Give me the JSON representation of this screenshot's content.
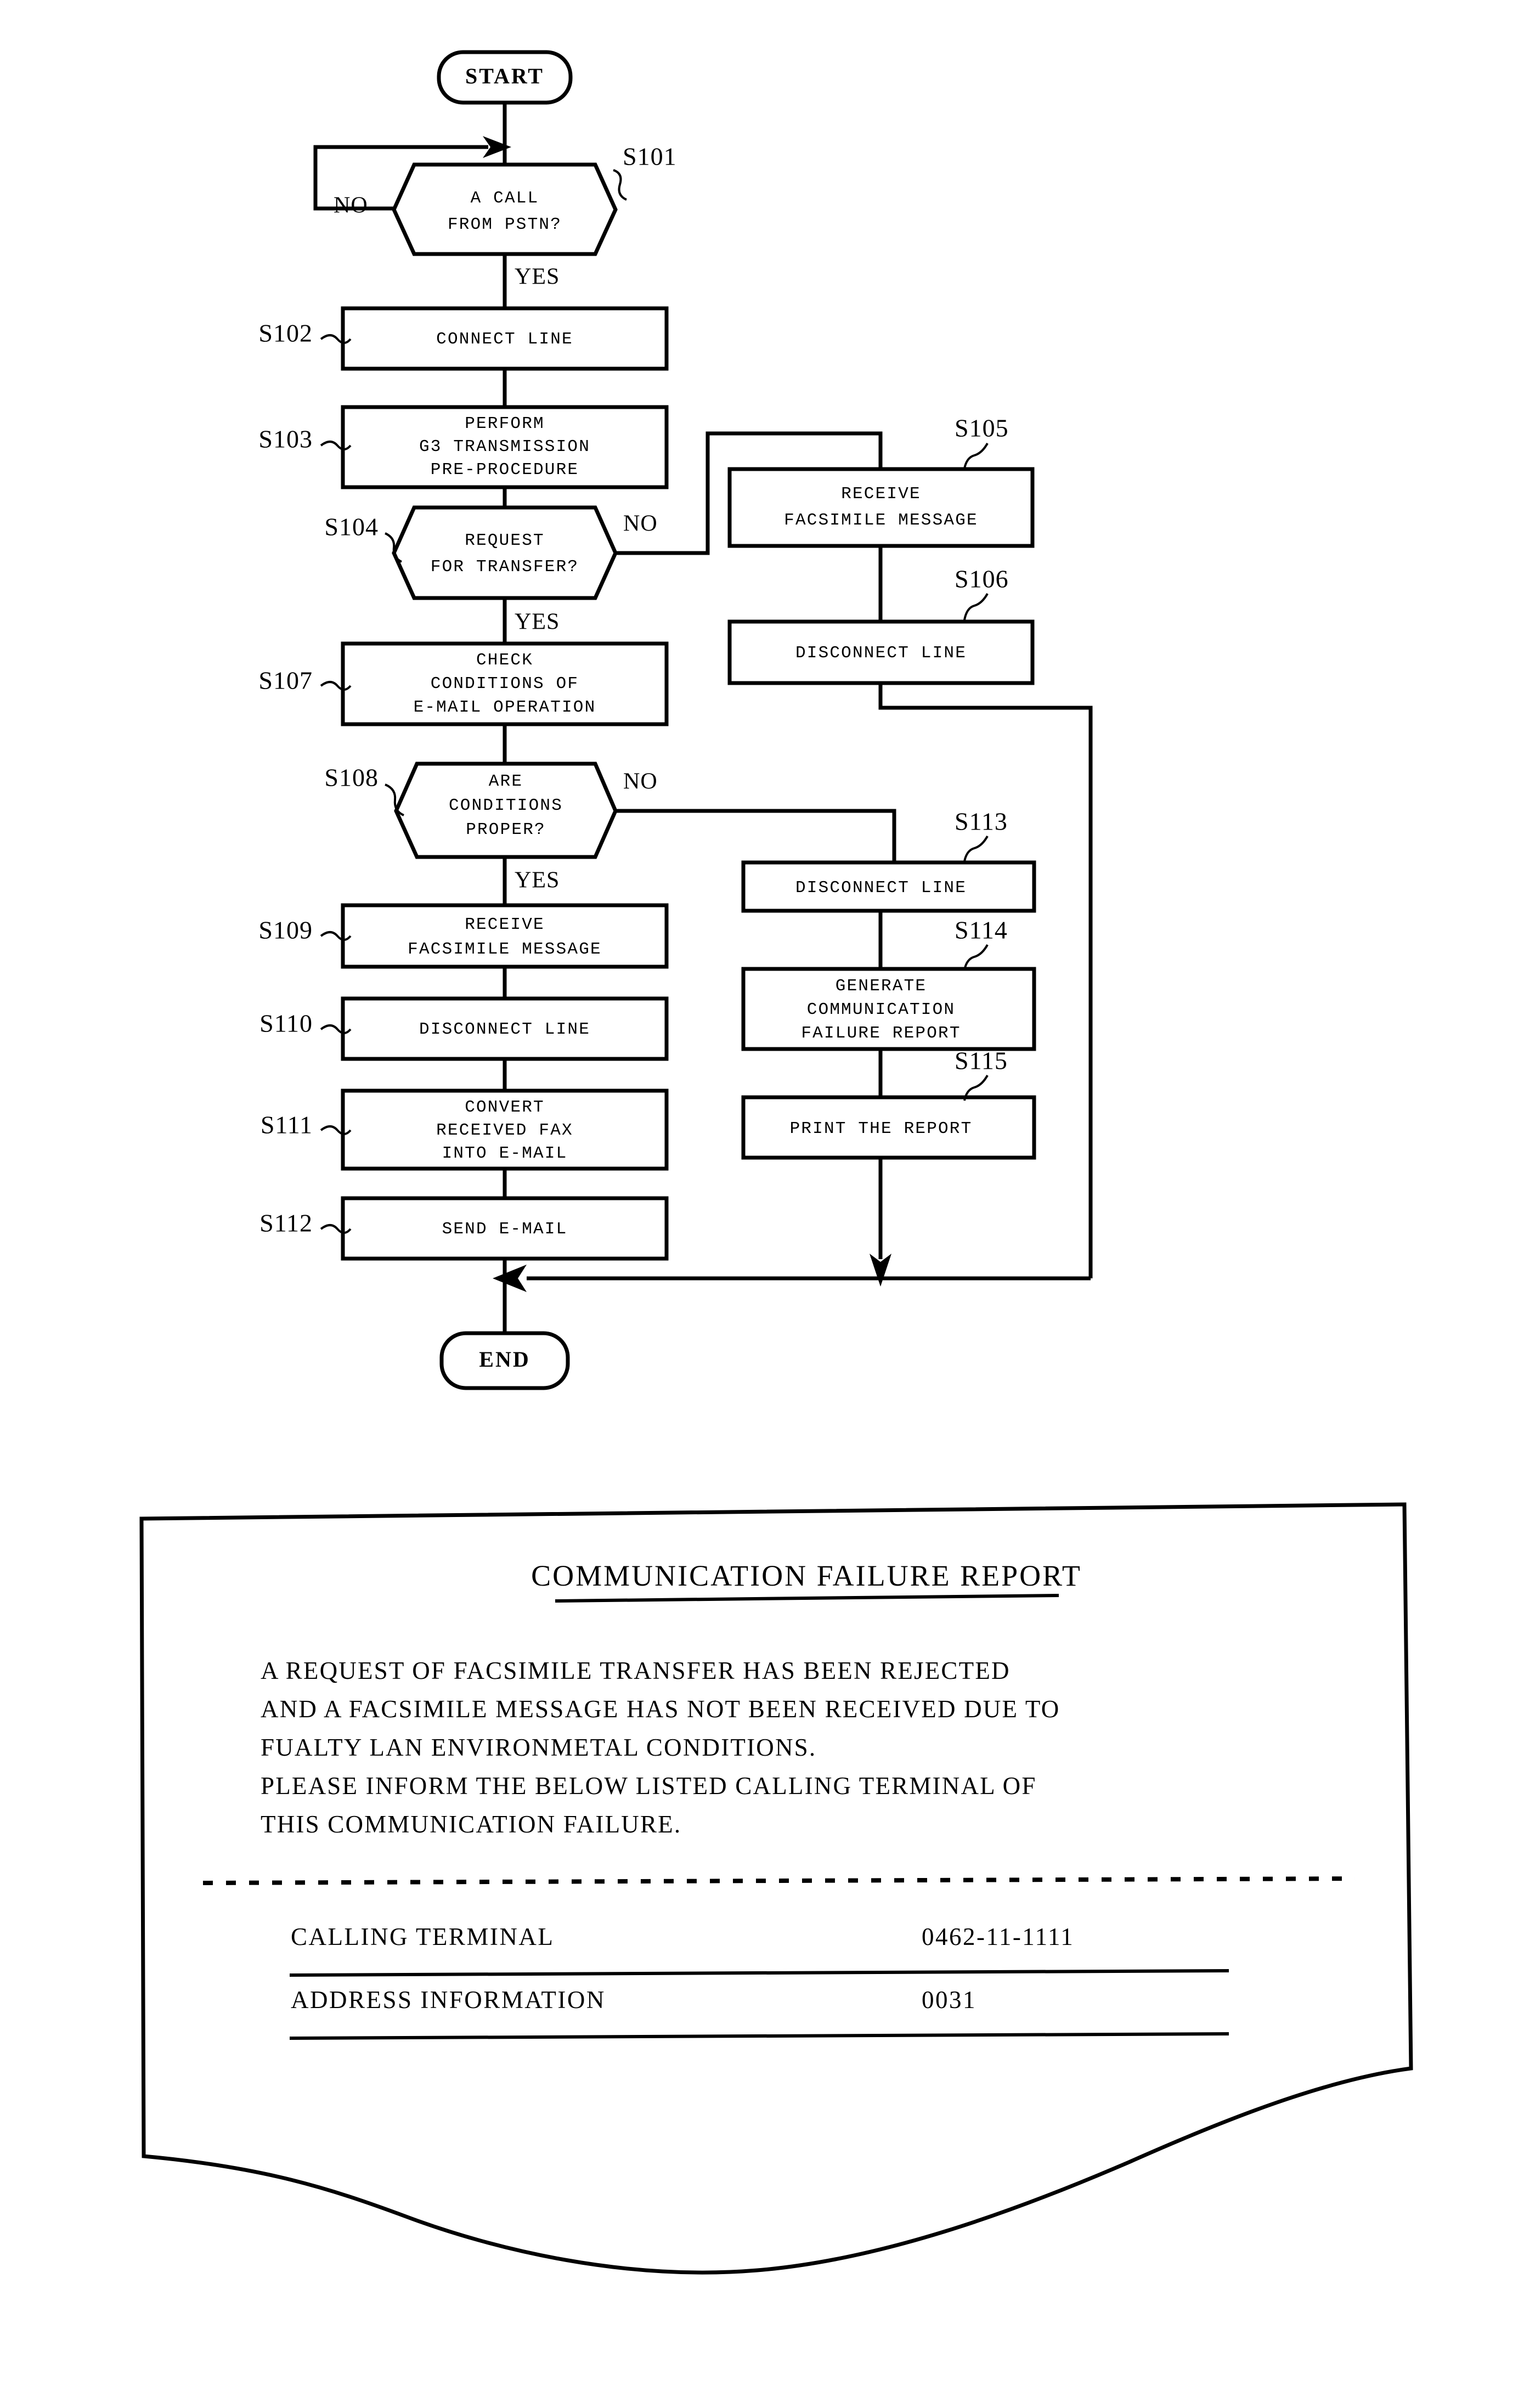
{
  "figure": {
    "type": "patent-flowchart",
    "terminals": {
      "start": "START",
      "end": "END"
    },
    "branch_labels": {
      "yes": "YES",
      "no": "NO"
    },
    "nodes": [
      {
        "id": "S101",
        "ref": "S101",
        "shape": "decision",
        "lines": [
          "A CALL",
          "FROM PSTN?"
        ]
      },
      {
        "id": "S102",
        "ref": "S102",
        "shape": "process",
        "lines": [
          "CONNECT LINE"
        ]
      },
      {
        "id": "S103",
        "ref": "S103",
        "shape": "process",
        "lines": [
          "PERFORM",
          "G3 TRANSMISSION",
          "PRE-PROCEDURE"
        ]
      },
      {
        "id": "S104",
        "ref": "S104",
        "shape": "decision",
        "lines": [
          "REQUEST",
          "FOR TRANSFER?"
        ]
      },
      {
        "id": "S105",
        "ref": "S105",
        "shape": "process",
        "lines": [
          "RECEIVE",
          "FACSIMILE MESSAGE"
        ]
      },
      {
        "id": "S106",
        "ref": "S106",
        "shape": "process",
        "lines": [
          "DISCONNECT LINE"
        ]
      },
      {
        "id": "S107",
        "ref": "S107",
        "shape": "process",
        "lines": [
          "CHECK",
          "CONDITIONS OF",
          "E-MAIL OPERATION"
        ]
      },
      {
        "id": "S108",
        "ref": "S108",
        "shape": "decision",
        "lines": [
          "ARE",
          "CONDITIONS",
          "PROPER?"
        ]
      },
      {
        "id": "S109",
        "ref": "S109",
        "shape": "process",
        "lines": [
          "RECEIVE",
          "FACSIMILE MESSAGE"
        ]
      },
      {
        "id": "S110",
        "ref": "S110",
        "shape": "process",
        "lines": [
          "DISCONNECT LINE"
        ]
      },
      {
        "id": "S111",
        "ref": "S111",
        "shape": "process",
        "lines": [
          "CONVERT",
          "RECEIVED FAX",
          "INTO E-MAIL"
        ]
      },
      {
        "id": "S112",
        "ref": "S112",
        "shape": "process",
        "lines": [
          "SEND E-MAIL"
        ]
      },
      {
        "id": "S113",
        "ref": "S113",
        "shape": "process",
        "lines": [
          "DISCONNECT LINE"
        ]
      },
      {
        "id": "S114",
        "ref": "S114",
        "shape": "process",
        "lines": [
          "GENERATE",
          "COMMUNICATION",
          "FAILURE REPORT"
        ]
      },
      {
        "id": "S115",
        "ref": "S115",
        "shape": "process",
        "lines": [
          "PRINT THE REPORT"
        ]
      }
    ]
  },
  "report": {
    "title": "COMMUNICATION FAILURE REPORT",
    "body_lines": [
      "A REQUEST OF FACSIMILE TRANSFER HAS BEEN REJECTED",
      "AND A FACSIMILE MESSAGE HAS NOT BEEN RECEIVED DUE TO",
      "FUALTY LAN ENVIRONMETAL CONDITIONS.",
      "PLEASE INFORM THE BELOW LISTED CALLING TERMINAL OF",
      "THIS COMMUNICATION FAILURE."
    ],
    "table_rows": [
      {
        "label": "CALLING TERMINAL",
        "value": "0462-11-1111"
      },
      {
        "label": "ADDRESS INFORMATION",
        "value": "0031"
      }
    ]
  },
  "colors": {
    "ink": "#000000",
    "paper": "#ffffff"
  }
}
